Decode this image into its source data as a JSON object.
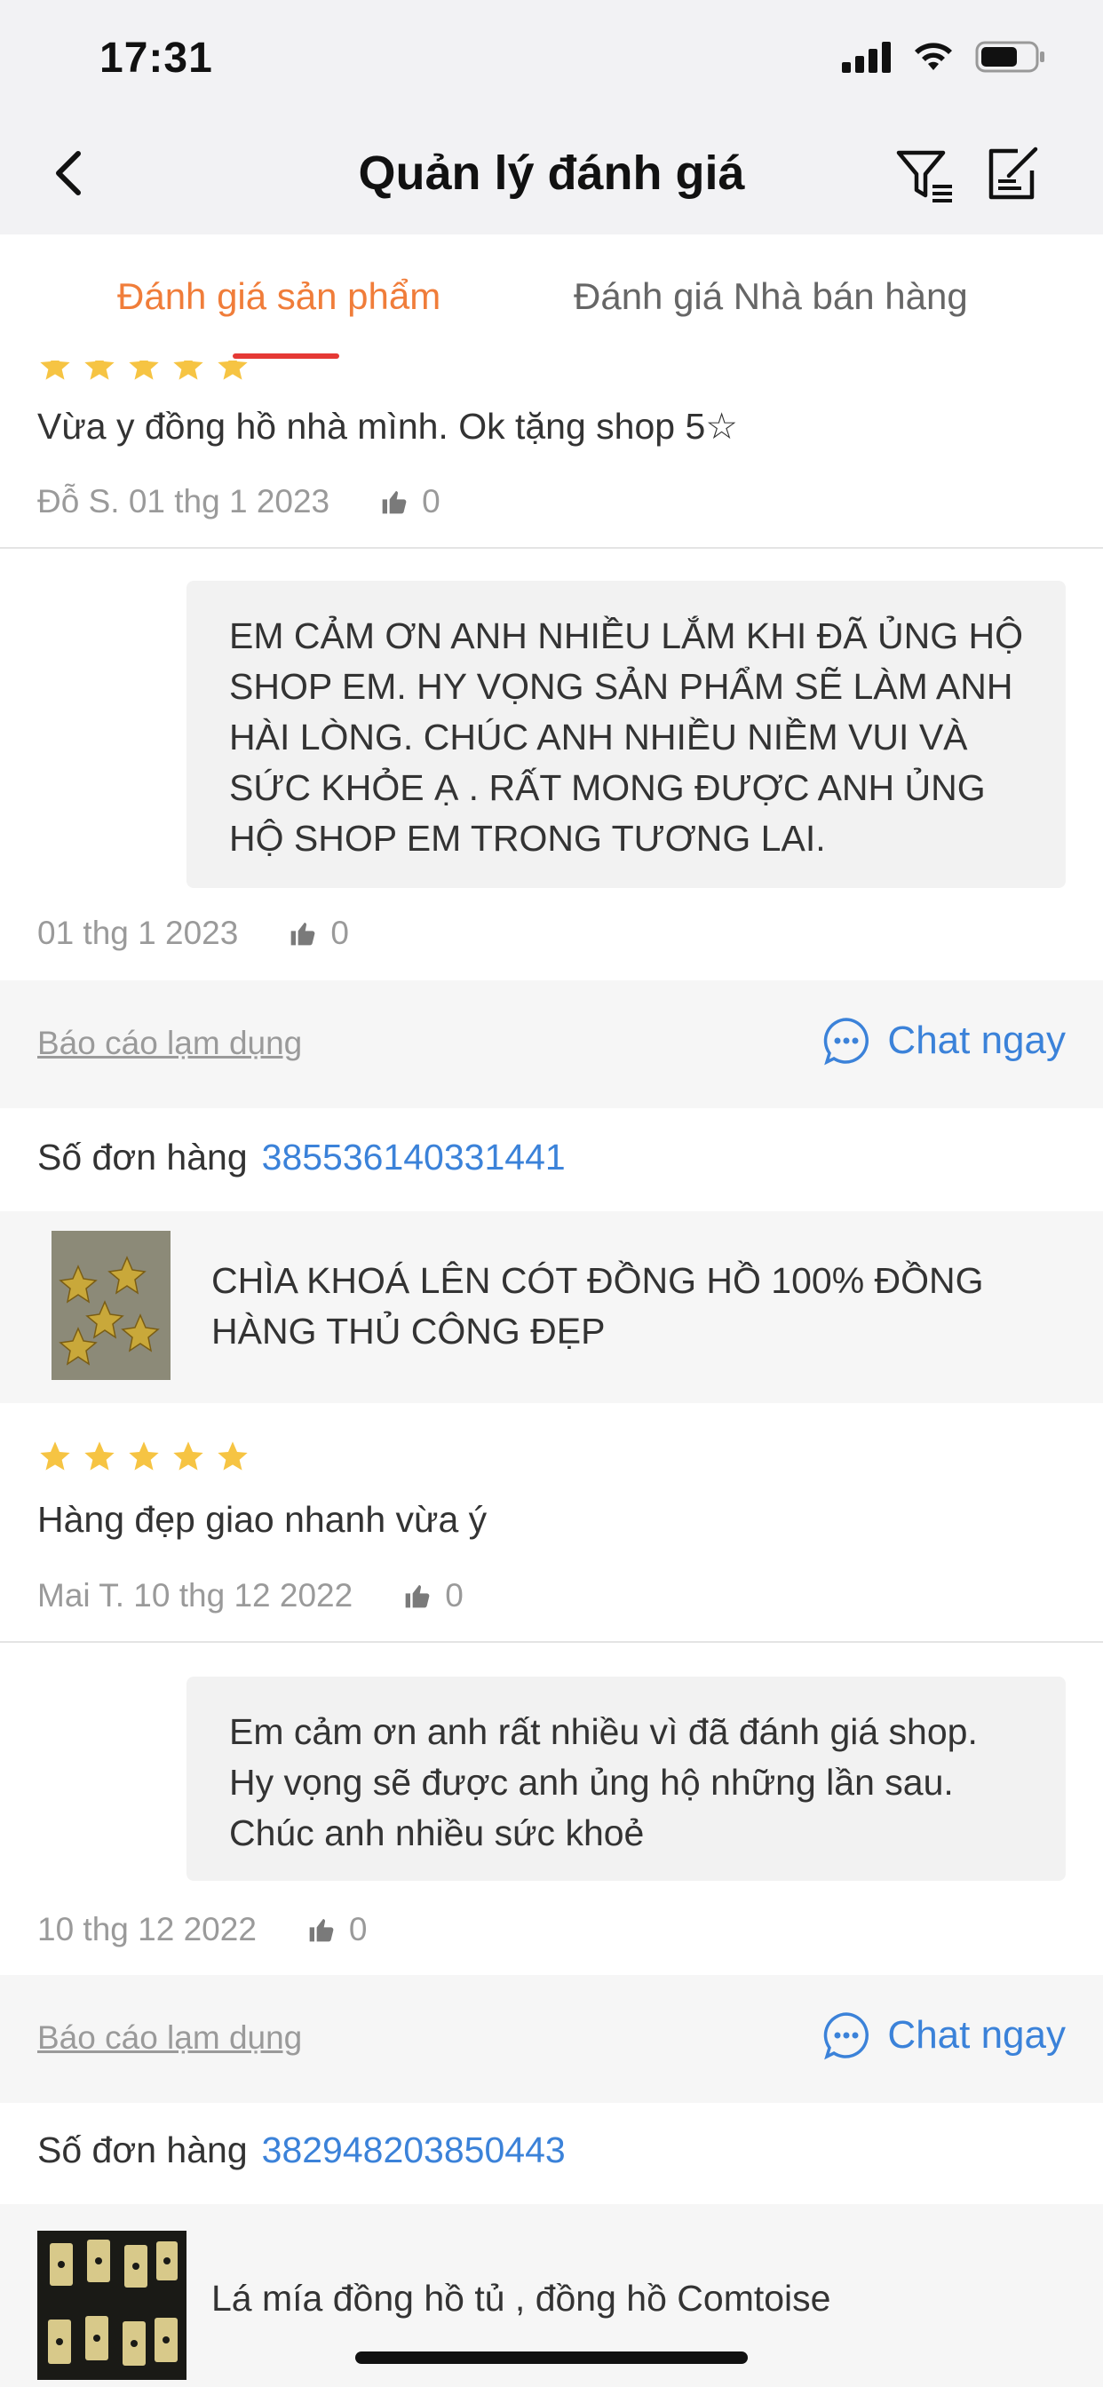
{
  "status_bar": {
    "time": "17:31"
  },
  "nav": {
    "title": "Quản lý đánh giá"
  },
  "tabs": [
    {
      "label": "Đánh giá sản phẩm",
      "active": true
    },
    {
      "label": "Đánh giá Nhà bán hàng",
      "active": false
    }
  ],
  "colors": {
    "accent": "#f07d3a",
    "tab_underline": "#e53935",
    "link": "#3b82d9",
    "star": "#f6c443"
  },
  "reviews": [
    {
      "rating": 5,
      "text": "Vừa y đồng hồ nhà mình. Ok tặng shop 5☆",
      "meta": "Đỗ S. 01 thg 1 2023",
      "likes": "0",
      "reply": {
        "text": "EM CẢM ƠN ANH NHIỀU LẮM KHI ĐÃ ỦNG HỘ SHOP EM. HY VỌNG SẢN PHẨM SẼ LÀM ANH HÀI LÒNG. CHÚC ANH NHIỀU NIỀM VUI VÀ SỨC KHỎE Ạ . RẤT MONG ĐƯỢC ANH ỦNG HỘ SHOP EM TRONG TƯƠNG LAI.",
        "meta": "01 thg 1 2023",
        "likes": "0"
      },
      "report_label": "Báo cáo lạm dụng",
      "chat_label": "Chat ngay"
    },
    {
      "order_label": "Số đơn hàng",
      "order_number": "385536140331441",
      "product_name": "CHÌA KHOÁ LÊN CÓT ĐỒNG HỒ 100% ĐỒNG HÀNG THỦ CÔNG ĐẸP",
      "rating": 5,
      "text": "Hàng đẹp giao nhanh vừa ý",
      "meta": "Mai T. 10 thg 12 2022",
      "likes": "0",
      "reply": {
        "text": "Em cảm ơn anh rất nhiều vì đã đánh giá shop. Hy vọng sẽ được anh ủng hộ những lần sau. Chúc anh nhiều sức khoẻ",
        "meta": "10 thg 12 2022",
        "likes": "0"
      },
      "report_label": "Báo cáo lạm dụng",
      "chat_label": "Chat ngay"
    },
    {
      "order_label": "Số đơn hàng",
      "order_number": "382948203850443",
      "product_name": "Lá mía đồng hồ tủ , đồng hồ Comtoise"
    }
  ]
}
